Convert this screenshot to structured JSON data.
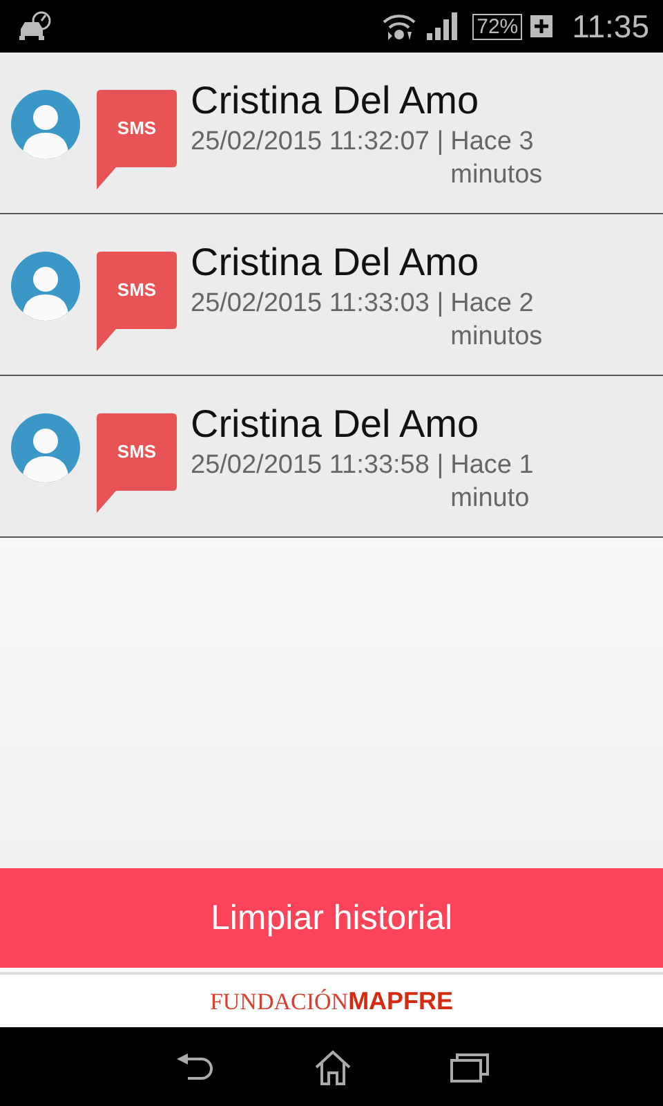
{
  "status_bar": {
    "battery": "72%",
    "time": "11:35"
  },
  "history": [
    {
      "name": "Cristina Del Amo",
      "channel": "SMS",
      "datetime": "25/02/2015 11:32:07 |",
      "ago": "Hace 3 minutos"
    },
    {
      "name": "Cristina Del Amo",
      "channel": "SMS",
      "datetime": "25/02/2015 11:33:03 |",
      "ago": "Hace 2 minutos"
    },
    {
      "name": "Cristina Del Amo",
      "channel": "SMS",
      "datetime": "25/02/2015 11:33:58 |",
      "ago": "Hace 1 minuto"
    }
  ],
  "clear_button": "Limpiar historial",
  "footer_logo": {
    "first": "FUNDACIÓN",
    "second": "MAPFRE"
  }
}
